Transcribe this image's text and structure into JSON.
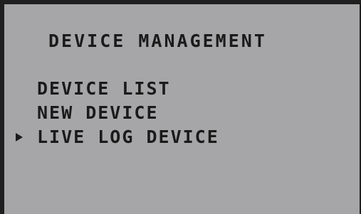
{
  "screen": {
    "title": "DEVICE MANAGEMENT",
    "colors": {
      "background": "#a6a6a8",
      "text": "#1a1a1a",
      "bezel": "#1f1f1f"
    }
  },
  "menu": {
    "items": [
      {
        "label": "DEVICE LIST",
        "selected": false
      },
      {
        "label": "NEW DEVICE",
        "selected": false
      },
      {
        "label": "LIVE LOG DEVICE",
        "selected": true
      }
    ],
    "cursor_icon": "triangle-right-icon"
  }
}
